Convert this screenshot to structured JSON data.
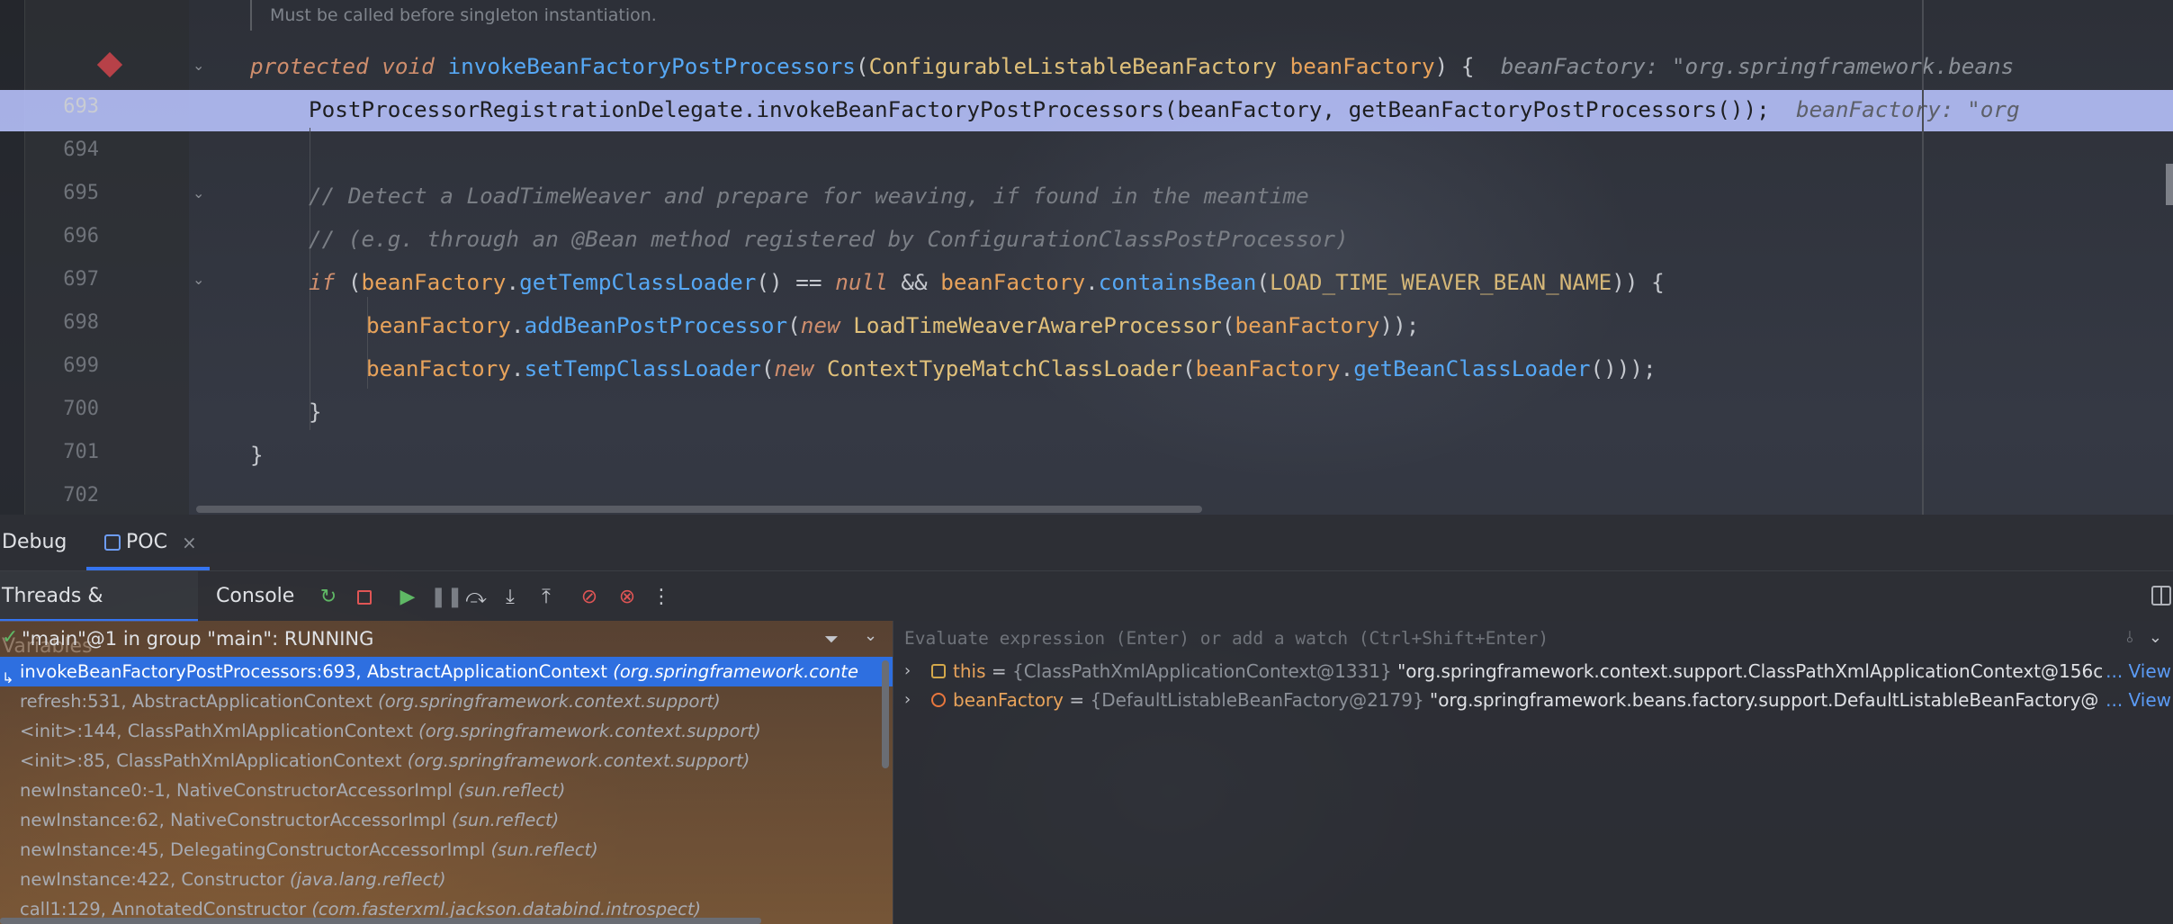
{
  "editor": {
    "javadoc": "Must be called before singleton instantiation.",
    "line_numbers": [
      "693",
      "694",
      "695",
      "696",
      "697",
      "698",
      "699",
      "700",
      "701",
      "702"
    ],
    "lines": {
      "l692": {
        "kw1": "protected",
        "kw2": "void",
        "method": "invokeBeanFactoryPostProcessors",
        "open": "(",
        "type": "ConfigurableListableBeanFactory",
        "param": "beanFactory",
        "close": ") {",
        "hint": "beanFactory: \"org.springframework.beans"
      },
      "l693": {
        "code": "PostProcessorRegistrationDelegate.invokeBeanFactoryPostProcessors(beanFactory, getBeanFactoryPostProcessors());",
        "hint": "beanFactory: \"org"
      },
      "l695": "// Detect a LoadTimeWeaver and prepare for weaving, if found in the meantime",
      "l696": "// (e.g. through an @Bean method registered by ConfigurationClassPostProcessor)",
      "l697": {
        "kw_if": "if",
        "p1": " (",
        "recv": "beanFactory",
        "dot": ".",
        "m1": "getTempClassLoader",
        "mid": "() == ",
        "kw_null": "null",
        "and": " && ",
        "recv2": "beanFactory",
        "dot2": ".",
        "m2": "containsBean",
        "p2": "(",
        "const": "LOAD_TIME_WEAVER_BEAN_NAME",
        "end": ")) {"
      },
      "l698": {
        "recv": "beanFactory",
        "dot": ".",
        "m": "addBeanPostProcessor",
        "p": "(",
        "kw_new": "new",
        "sp": " ",
        "type": "LoadTimeWeaverAwareProcessor",
        "p2": "(",
        "arg": "beanFactory",
        "end": "));"
      },
      "l699": {
        "recv": "beanFactory",
        "dot": ".",
        "m": "setTempClassLoader",
        "p": "(",
        "kw_new": "new",
        "sp": " ",
        "type": "ContextTypeMatchClassLoader",
        "p2": "(",
        "arg": "beanFactory",
        "dot2": ".",
        "m2": "getBeanClassLoader",
        "end": "()));"
      },
      "l700": "}",
      "l701": "}"
    }
  },
  "debug": {
    "title": "Debug",
    "session_tab": "POC",
    "close_glyph": "×",
    "tabs": {
      "threads": "Threads & Variables",
      "console": "Console"
    },
    "thread": "\"main\"@1 in group \"main\": RUNNING",
    "frames": [
      {
        "method": "invokeBeanFactoryPostProcessors:693, AbstractApplicationContext ",
        "pkg": "(org.springframework.conte"
      },
      {
        "method": "refresh:531, AbstractApplicationContext ",
        "pkg": "(org.springframework.context.support)"
      },
      {
        "method": "<init>:144, ClassPathXmlApplicationContext ",
        "pkg": "(org.springframework.context.support)"
      },
      {
        "method": "<init>:85, ClassPathXmlApplicationContext ",
        "pkg": "(org.springframework.context.support)"
      },
      {
        "method": "newInstance0:-1, NativeConstructorAccessorImpl ",
        "pkg": "(sun.reflect)"
      },
      {
        "method": "newInstance:62, NativeConstructorAccessorImpl ",
        "pkg": "(sun.reflect)"
      },
      {
        "method": "newInstance:45, DelegatingConstructorAccessorImpl ",
        "pkg": "(sun.reflect)"
      },
      {
        "method": "newInstance:422, Constructor ",
        "pkg": "(java.lang.reflect)"
      },
      {
        "method": "call1:129, AnnotatedConstructor ",
        "pkg": "(com.fasterxml.jackson.databind.introspect)"
      }
    ],
    "evaluate_placeholder": "Evaluate expression (Enter) or add a watch (Ctrl+Shift+Enter)",
    "variables": [
      {
        "name": "this",
        "eq": " = ",
        "type": "{ClassPathXmlApplicationContext@1331}",
        "value": " \"org.springframework.context.support.ClassPathXmlApplicationContext@156c",
        "view": "... View"
      },
      {
        "name": "beanFactory",
        "eq": " = ",
        "type": "{DefaultListableBeanFactory@2179}",
        "value": " \"org.springframework.beans.factory.support.DefaultListableBeanFactory@",
        "view": "... View"
      }
    ]
  }
}
